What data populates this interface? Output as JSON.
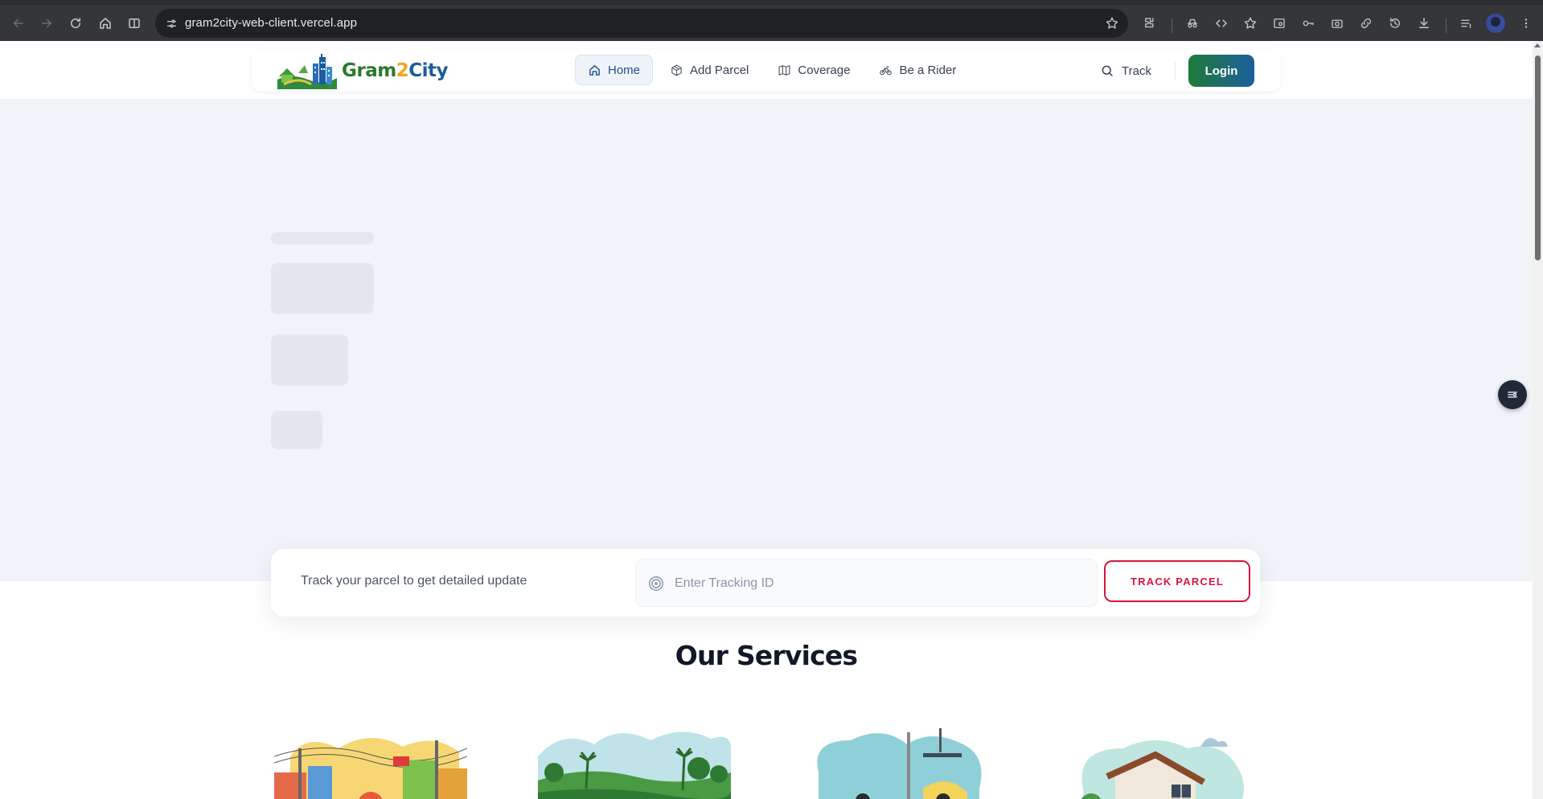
{
  "browser": {
    "url": "gram2city-web-client.vercel.app"
  },
  "site": {
    "logo": {
      "part1": "Gram",
      "part2": "2",
      "part3": "City"
    },
    "nav": [
      {
        "label": "Home",
        "icon": "home-icon",
        "active": true
      },
      {
        "label": "Add Parcel",
        "icon": "package-icon",
        "active": false
      },
      {
        "label": "Coverage",
        "icon": "map-icon",
        "active": false
      },
      {
        "label": "Be a Rider",
        "icon": "bike-icon",
        "active": false
      }
    ],
    "track_link": "Track",
    "login": "Login"
  },
  "tracking": {
    "message": "Track your parcel to get detailed update",
    "placeholder": "Enter Tracking ID",
    "button": "TRACK PARCEL"
  },
  "services": {
    "title": "Our Services"
  },
  "colors": {
    "brand_green": "#2a7a2e",
    "brand_blue": "#1b5c9c",
    "accent_red": "#d5173f",
    "hero_bg": "#f0f3f7"
  }
}
